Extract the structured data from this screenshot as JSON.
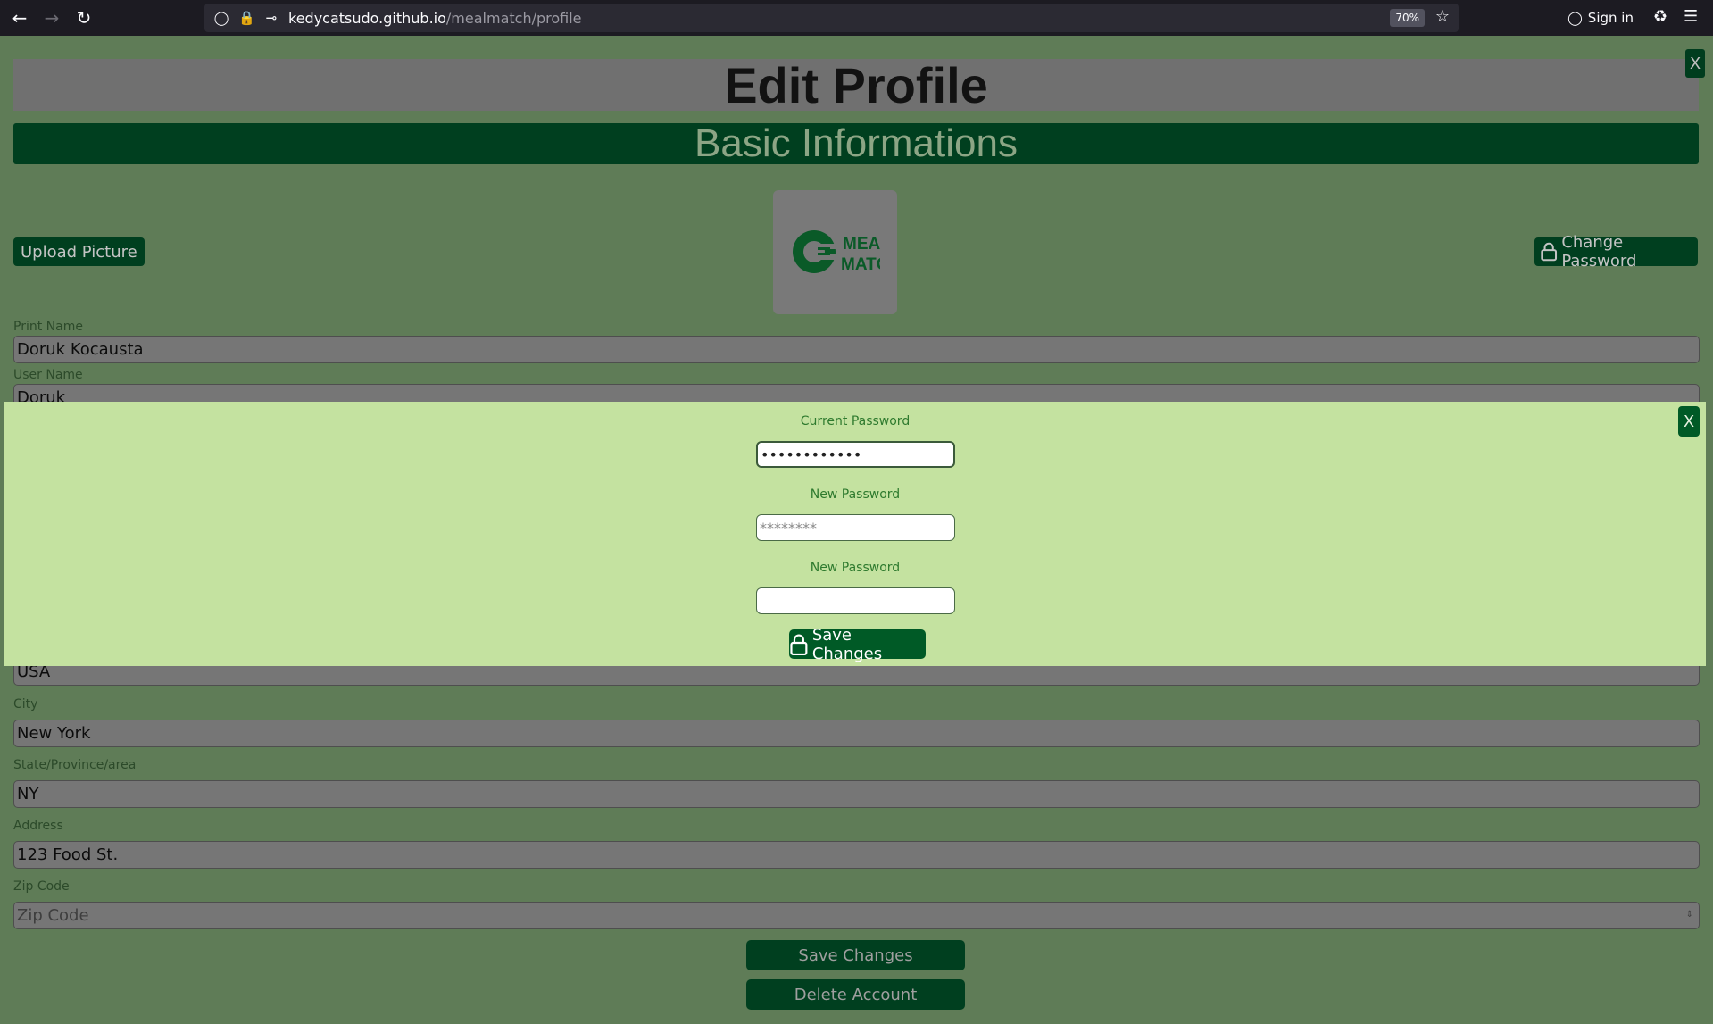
{
  "browser": {
    "url_host": "kedycatsudo.github.io",
    "url_path": "/mealmatch/profile",
    "zoom": "70%",
    "sign_in": "Sign in"
  },
  "page": {
    "title": "Edit Profile",
    "close_label": "X",
    "section": "Basic Informations",
    "upload_label": "Upload Picture",
    "change_password_label": "Change Password",
    "logo_text_1": "MEAL",
    "logo_text_2": "MATCH",
    "fields": {
      "print_name": {
        "label": "Print Name",
        "value": "Doruk Kocausta"
      },
      "user_name": {
        "label": "User Name",
        "value": "Doruk"
      },
      "country": {
        "value": "USA"
      },
      "city": {
        "label": "City",
        "value": "New York"
      },
      "state": {
        "label": "State/Province/area",
        "value": "NY"
      },
      "address": {
        "label": "Address",
        "value": "123 Food St."
      },
      "zip": {
        "label": "Zip Code",
        "placeholder": "Zip Code"
      }
    },
    "save_label": "Save Changes",
    "delete_label": "Delete Account"
  },
  "modal": {
    "close_label": "X",
    "current_password_label": "Current Password",
    "current_password_value": "••••••••••••",
    "new_password_label": "New Password",
    "new_password_value": "********",
    "confirm_password_label": "New Password",
    "confirm_password_value": "",
    "save_label": "Save Changes"
  },
  "colors": {
    "page_bg": "#5f7c57",
    "dark_green": "#003f1f",
    "modal_bg": "#c4e2a0",
    "modal_button": "#005a26"
  }
}
